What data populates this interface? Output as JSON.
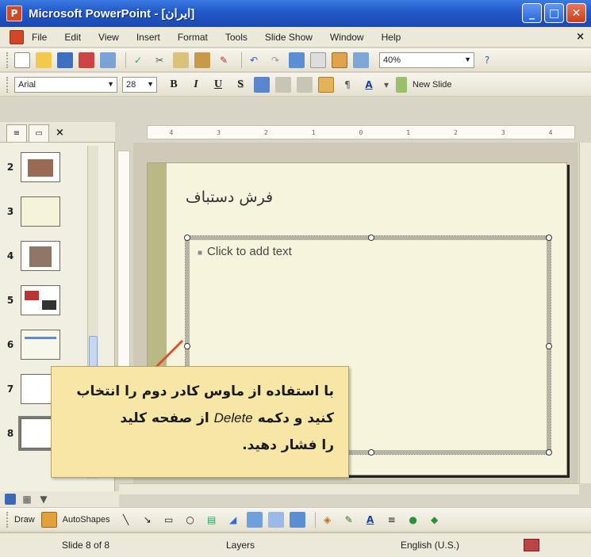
{
  "window": {
    "title": "Microsoft PowerPoint - [ايران]",
    "app_icon": "P",
    "minimize": "_",
    "maximize": "□",
    "close": "✕"
  },
  "menu": {
    "items": [
      "File",
      "Edit",
      "View",
      "Insert",
      "Format",
      "Tools",
      "Slide Show",
      "Window",
      "Help"
    ],
    "close_glyph": "×"
  },
  "standard_toolbar": {
    "zoom": "40%"
  },
  "formatting_toolbar": {
    "font": "Arial",
    "size": "28",
    "bold": "B",
    "italic": "I",
    "underline": "U",
    "shadow": "S",
    "new_slide": "New Slide"
  },
  "left_pane": {
    "tabs": [
      "outline",
      "slides"
    ],
    "close_glyph": "×",
    "thumbnails": [
      {
        "num": "2"
      },
      {
        "num": "3"
      },
      {
        "num": "4"
      },
      {
        "num": "5"
      },
      {
        "num": "6"
      },
      {
        "num": "7"
      },
      {
        "num": "8"
      }
    ]
  },
  "ruler": {
    "labels": [
      "4",
      "3",
      "2",
      "1",
      "0",
      "1",
      "2",
      "3",
      "4"
    ]
  },
  "slide": {
    "title": "فرش دستباف",
    "body_placeholder": "Click to add text",
    "bullet": "■"
  },
  "callout": {
    "line1": "با استفاده از ماوس کادر دوم را انتخاب",
    "line2_start": "کنید و دکمه",
    "line2_key": "Delete",
    "line2_end": "از صفحه کلید",
    "line3": "را فشار دهید."
  },
  "draw_toolbar": {
    "draw": "Draw",
    "autoshapes": "AutoShapes"
  },
  "status": {
    "slide": "Slide 8 of 8",
    "design": "Layers",
    "language": "English (U.S.)"
  },
  "colors": {
    "titlebar": "#2258c9",
    "slide_bg": "#f7f4dd",
    "slide_bar": "#b8b985",
    "callout": "#f6e7a6",
    "pointer": "#d9532a"
  }
}
